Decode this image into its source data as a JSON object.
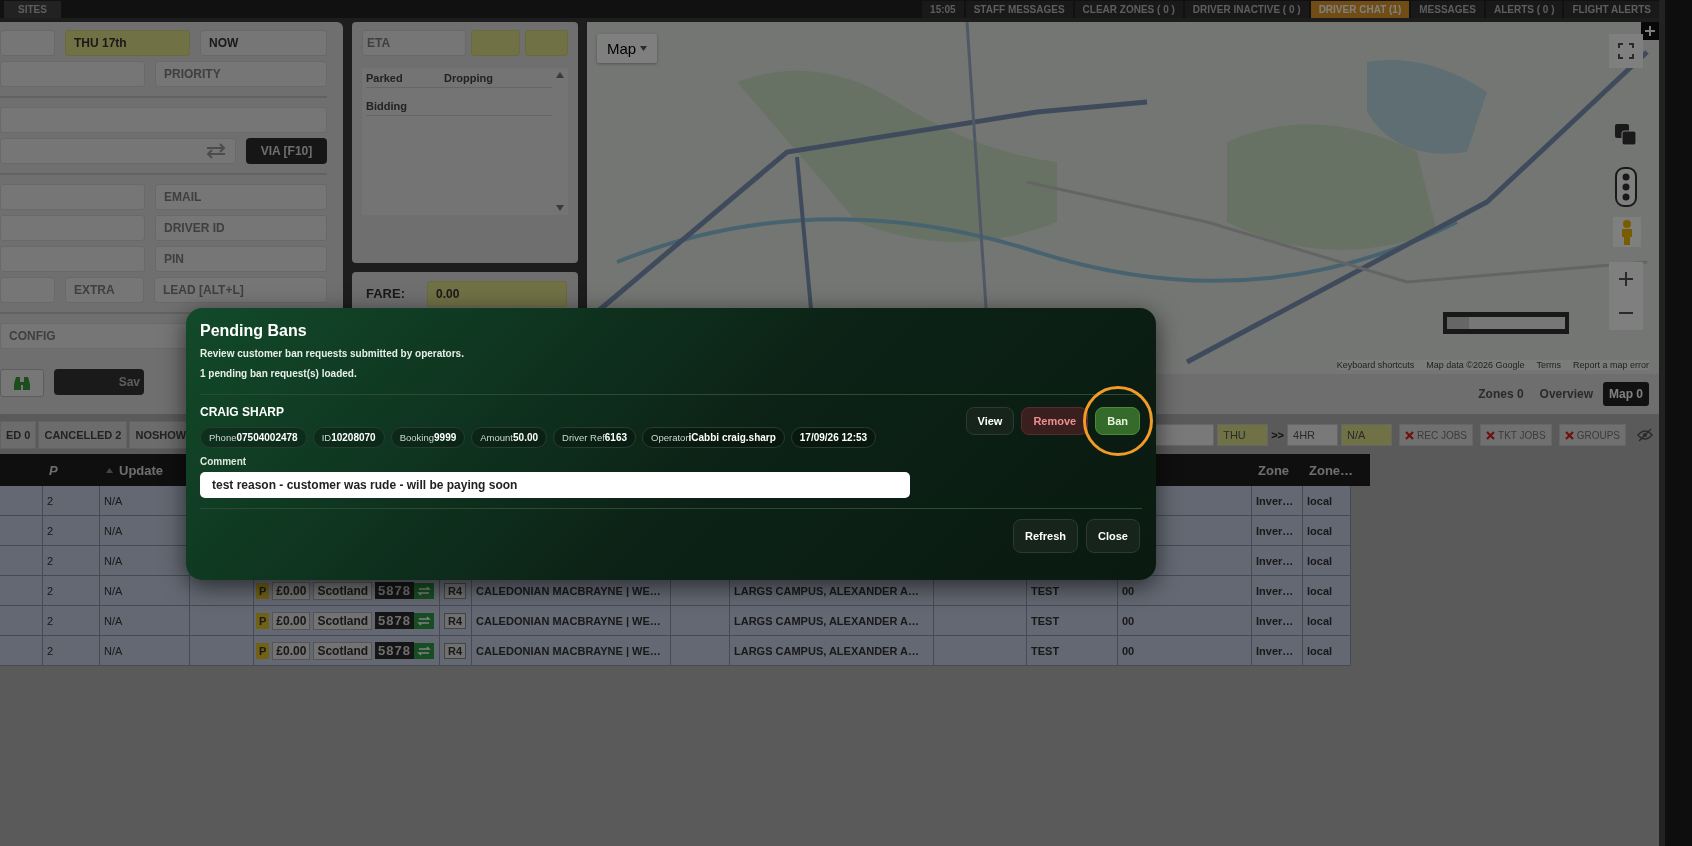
{
  "top_bar": {
    "site_tab": "SITES",
    "items": [
      {
        "label": "15:05",
        "alert": false
      },
      {
        "label": "STAFF MESSAGES",
        "alert": false
      },
      {
        "label": "CLEAR ZONES ( 0 )",
        "alert": false
      },
      {
        "label": "DRIVER INACTIVE ( 0 )",
        "alert": false
      },
      {
        "label": "DRIVER CHAT (1)",
        "alert": true
      },
      {
        "label": "MESSAGES",
        "alert": false
      },
      {
        "label": "ALERTS ( 0 )",
        "alert": false
      },
      {
        "label": "FLIGHT ALERTS",
        "alert": false
      }
    ]
  },
  "booking_form": {
    "sections": [
      [
        {
          "fields": [
            {
              "kind": "blank"
            },
            {
              "kind": "value",
              "value": "THU 17th",
              "highlighted": true
            },
            {
              "kind": "value",
              "value": "NOW",
              "highlighted": false
            }
          ]
        },
        {
          "fields": [
            {
              "kind": "blank"
            },
            {
              "kind": "input",
              "placeholder": "PRIORITY"
            }
          ]
        }
      ],
      [
        {
          "fields": [
            {
              "kind": "blank"
            }
          ]
        },
        {
          "fields": [
            {
              "kind": "swap"
            },
            {
              "kind": "button",
              "label": "VIA [F10]"
            }
          ]
        }
      ],
      [
        {
          "fields": [
            {
              "kind": "blank"
            },
            {
              "kind": "input",
              "placeholder": "EMAIL"
            }
          ]
        },
        {
          "fields": [
            {
              "kind": "blank"
            },
            {
              "kind": "input",
              "placeholder": "DRIVER ID"
            }
          ]
        },
        {
          "fields": [
            {
              "kind": "blank"
            },
            {
              "kind": "input",
              "placeholder": "PIN"
            }
          ]
        },
        {
          "fields": [
            {
              "kind": "blank"
            },
            {
              "kind": "input",
              "placeholder": "EXTRA"
            },
            {
              "kind": "input",
              "placeholder": "LEAD [ALT+L]"
            }
          ]
        }
      ],
      [
        {
          "fields": [
            {
              "kind": "input",
              "placeholder": "CONFIG"
            }
          ]
        },
        {
          "fields": [
            {
              "kind": "icon_button"
            },
            {
              "kind": "button",
              "label": "Sav"
            }
          ]
        }
      ]
    ]
  },
  "eta_panel": {
    "eta_placeholder": "ETA",
    "list_columns": [
      "Parked",
      "Dropping"
    ],
    "list_rows": [
      "Bidding"
    ]
  },
  "fare": {
    "label": "FARE:",
    "value": "0.00"
  },
  "map": {
    "type_button": "Map",
    "attribution": [
      "Keyboard shortcuts",
      "Map data ©2026 Google",
      "Terms",
      "Report a map error"
    ],
    "footer": [
      {
        "label": "Zones 0",
        "selected": false
      },
      {
        "label": "Overview",
        "selected": false
      },
      {
        "label": "Map 0",
        "selected": true
      }
    ]
  },
  "status_tabs": [
    "ED 0",
    "CANCELLED 2",
    "NOSHOW"
  ],
  "filters": [
    {
      "kind": "blank"
    },
    {
      "kind": "value",
      "value": "THU",
      "highlighted": true
    },
    {
      "kind": "text",
      "value": ">>"
    },
    {
      "kind": "value",
      "value": "4HR",
      "highlighted": false
    },
    {
      "kind": "value",
      "value": "N/A",
      "highlighted": true
    }
  ],
  "toggles": [
    "REC JOBS",
    "TKT JOBS",
    "GROUPS"
  ],
  "table": {
    "columns": [
      {
        "kind": "hidden"
      },
      {
        "kind": "priority",
        "label": "P"
      },
      {
        "kind": "sort",
        "label": "Update",
        "sorted": true
      },
      {
        "kind": "hidden"
      },
      {
        "kind": "hidden"
      },
      {
        "kind": "hidden"
      },
      {
        "kind": "hidden"
      },
      {
        "kind": "hidden"
      },
      {
        "kind": "hidden"
      },
      {
        "kind": "hidden"
      },
      {
        "kind": "hidden"
      },
      {
        "kind": "hidden"
      },
      {
        "kind": "plain",
        "label": "Zone"
      },
      {
        "kind": "plain",
        "label": "Zone…"
      }
    ],
    "rows": [
      {
        "p": "2",
        "update": "N/A",
        "zone": "Inver…",
        "zone_2": "local"
      },
      {
        "p": "2",
        "update": "N/A",
        "zone": "Inver…",
        "zone_2": "local"
      },
      {
        "p": "2",
        "update": "N/A",
        "zone": "Inver…",
        "zone_2": "local"
      },
      {
        "p": "2",
        "update": "N/A",
        "zone": "Inver…",
        "zone_2": "local",
        "job": {
          "badge": "P",
          "price": "£0.00",
          "region": "Scotland",
          "vehicle": "5878",
          "route": "R4",
          "pickup": "CALEDONIAN MACBRAYNE | WE…",
          "dropoff": "LARGS CAMPUS, ALEXANDER A…",
          "name": "TEST",
          "code": "00"
        }
      },
      {
        "p": "2",
        "update": "N/A",
        "zone": "Inver…",
        "zone_2": "local",
        "job": {
          "badge": "P",
          "price": "£0.00",
          "region": "Scotland",
          "vehicle": "5878",
          "route": "R4",
          "pickup": "CALEDONIAN MACBRAYNE | WE…",
          "dropoff": "LARGS CAMPUS, ALEXANDER A…",
          "name": "TEST",
          "code": "00"
        }
      },
      {
        "p": "2",
        "update": "N/A",
        "zone": "Inver…",
        "zone_2": "local",
        "job": {
          "badge": "P",
          "price": "£0.00",
          "region": "Scotland",
          "vehicle": "5878",
          "route": "R4",
          "pickup": "CALEDONIAN MACBRAYNE | WE…",
          "dropoff": "LARGS CAMPUS, ALEXANDER A…",
          "name": "TEST",
          "code": "00"
        }
      }
    ]
  },
  "pending_bans_dialog": {
    "title": "Pending Bans",
    "subtitle": "Review customer ban requests submitted by operators.",
    "status": "1 pending ban request(s) loaded.",
    "requests": [
      {
        "name": "CRAIG SHARP",
        "details": [
          {
            "label": "Phone",
            "value": "07504002478"
          },
          {
            "label": "ID",
            "value": "10208070"
          },
          {
            "label": "Booking",
            "value": "9999"
          },
          {
            "label": "Amount",
            "value": "50.00"
          },
          {
            "label": "Driver Ref",
            "value": "6163"
          },
          {
            "label": "Operator",
            "value": "iCabbi craig.sharp"
          },
          {
            "value": "17/09/26 12:53"
          }
        ],
        "comment_label": "Comment",
        "comment": "test reason - customer was rude - will be paying soon",
        "actions": [
          {
            "label": "View",
            "kind": "neutral",
            "highlighted": false
          },
          {
            "label": "Remove",
            "kind": "danger",
            "highlighted": false
          },
          {
            "label": "Ban",
            "kind": "confirm",
            "highlighted": true
          }
        ]
      }
    ],
    "buttons": [
      "Refresh",
      "Close"
    ]
  }
}
